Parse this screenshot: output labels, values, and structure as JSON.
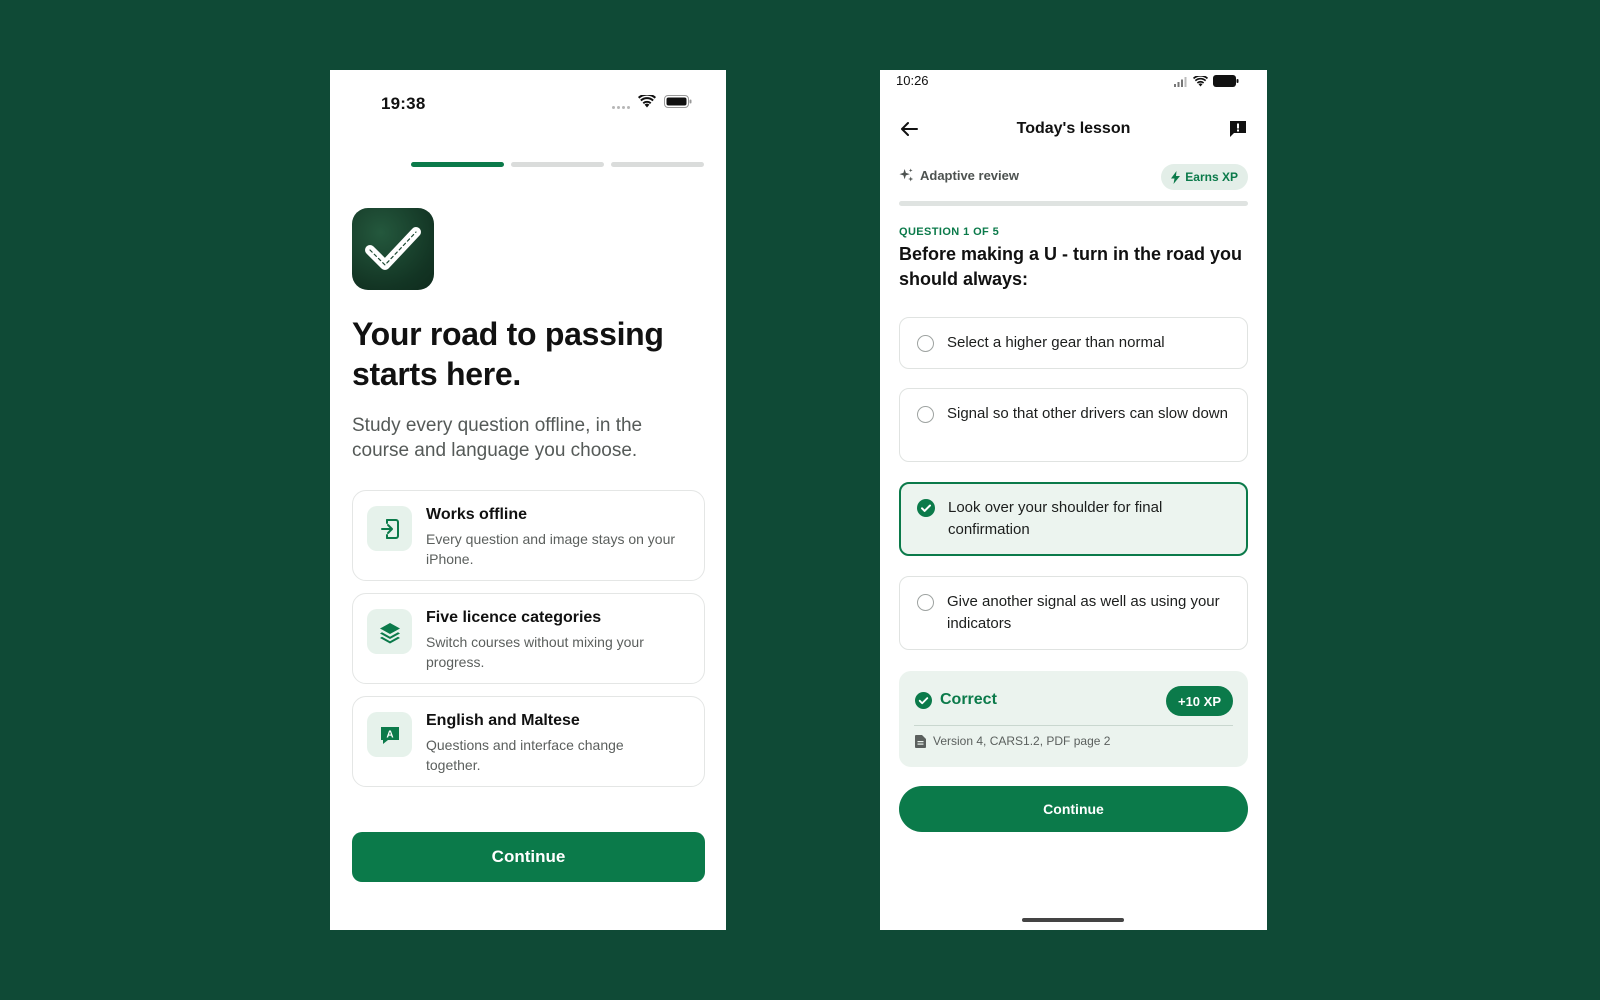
{
  "onboarding": {
    "status": {
      "time": "19:38"
    },
    "progress_steps": 3,
    "active_step": 1,
    "headline": "Your road to passing starts here.",
    "subhead": "Study every question offline, in the course and language you choose.",
    "features": [
      {
        "icon": "offline-device-icon",
        "title": "Works offline",
        "desc": "Every question and image stays on your iPhone."
      },
      {
        "icon": "layers-icon",
        "title": "Five licence categories",
        "desc": "Switch courses without mixing your progress."
      },
      {
        "icon": "language-icon",
        "icon_letter": "A",
        "title": "English and Maltese",
        "desc": "Questions and interface change together."
      }
    ],
    "continue_label": "Continue"
  },
  "lesson": {
    "status": {
      "time": "10:26"
    },
    "title": "Today's lesson",
    "mode_label": "Adaptive review",
    "xp_chip": "Earns XP",
    "progress": 0.0,
    "question_count": "QUESTION 1 OF 5",
    "question": "Before making a U - turn in the road you should always:",
    "options": [
      {
        "label": "Select a higher gear than normal",
        "selected": false
      },
      {
        "label": "Signal so that other drivers can slow down",
        "selected": false
      },
      {
        "label": "Look over your shoulder for final confirmation",
        "selected": true
      },
      {
        "label": "Give another signal as well as using your indicators",
        "selected": false
      }
    ],
    "feedback": {
      "result": "Correct",
      "xp": "+10 XP",
      "source": "Version 4, CARS1.2, PDF page 2"
    },
    "continue_label": "Continue"
  },
  "colors": {
    "background": "#0f4a36",
    "accent": "#0b7a4a",
    "accent_light": "#e6f2eb"
  }
}
